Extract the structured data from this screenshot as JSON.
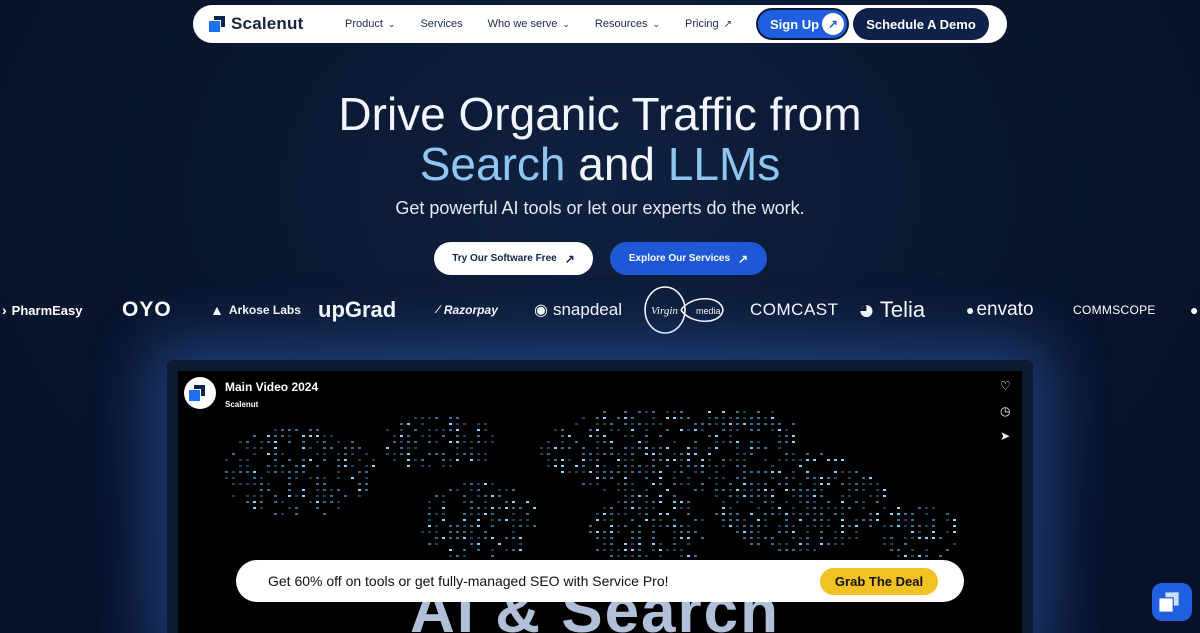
{
  "nav": {
    "logo_text": "Scalenut",
    "menu": [
      {
        "label": "Product",
        "icon": "chevron-down-icon"
      },
      {
        "label": "Services"
      },
      {
        "label": "Who we serve",
        "icon": "chevron-down-icon"
      },
      {
        "label": "Resources",
        "icon": "chevron-down-icon"
      },
      {
        "label": "Pricing",
        "icon": "external-arrow-icon"
      }
    ],
    "signup_label": "Sign Up",
    "demo_label": "Schedule A Demo"
  },
  "hero": {
    "line1": "Drive Organic Traffic from",
    "line2_a": "Search",
    "line2_b": "and",
    "line2_c": "LLMs",
    "subtitle": "Get powerful AI tools or let our experts do the work.",
    "cta_primary": "Try Our Software Free",
    "cta_secondary": "Explore Our Services"
  },
  "logos": [
    "PharmEasy",
    "OYO",
    "Arkose Labs",
    "upGrad",
    "Razorpay",
    "snapdeal",
    "Virgin media",
    "COMCAST",
    "Telia",
    "envato",
    "COMMSCOPE"
  ],
  "video": {
    "title": "Main Video 2024",
    "channel": "Scalenut",
    "overlay_text": "AI & Search"
  },
  "promo": {
    "text": "Get 60% off on tools or get fully-managed SEO with Service Pro!",
    "button": "Grab The Deal"
  },
  "colors": {
    "background": "#0a1730",
    "accent": "#8fc6f1",
    "primary_button": "#1f58d6",
    "deal_button": "#f0c222"
  }
}
